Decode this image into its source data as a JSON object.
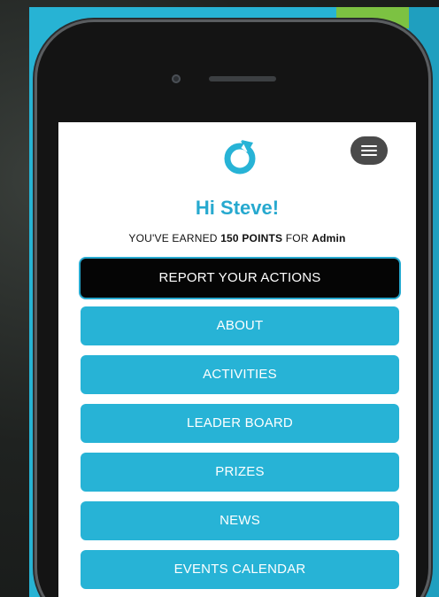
{
  "app": {
    "greeting": "Hi Steve!",
    "points_prefix": "YOU'VE EARNED",
    "points_value": "150 POINTS",
    "points_middle": "FOR",
    "points_org": "Admin"
  },
  "menu": {
    "primary": "REPORT YOUR ACTIONS",
    "items": [
      {
        "label": "ABOUT"
      },
      {
        "label": "ACTIVITIES"
      },
      {
        "label": "LEADER BOARD"
      },
      {
        "label": "PRIZES"
      },
      {
        "label": "NEWS"
      },
      {
        "label": "EVENTS CALENDAR"
      }
    ]
  },
  "icons": {
    "logo": "refresh-circle-logo-icon",
    "menu": "hamburger-menu-icon"
  },
  "colors": {
    "accent": "#27b3d6",
    "green": "#7cc242",
    "dark_button": "#050505",
    "menu_button": "#4a4a4a"
  }
}
